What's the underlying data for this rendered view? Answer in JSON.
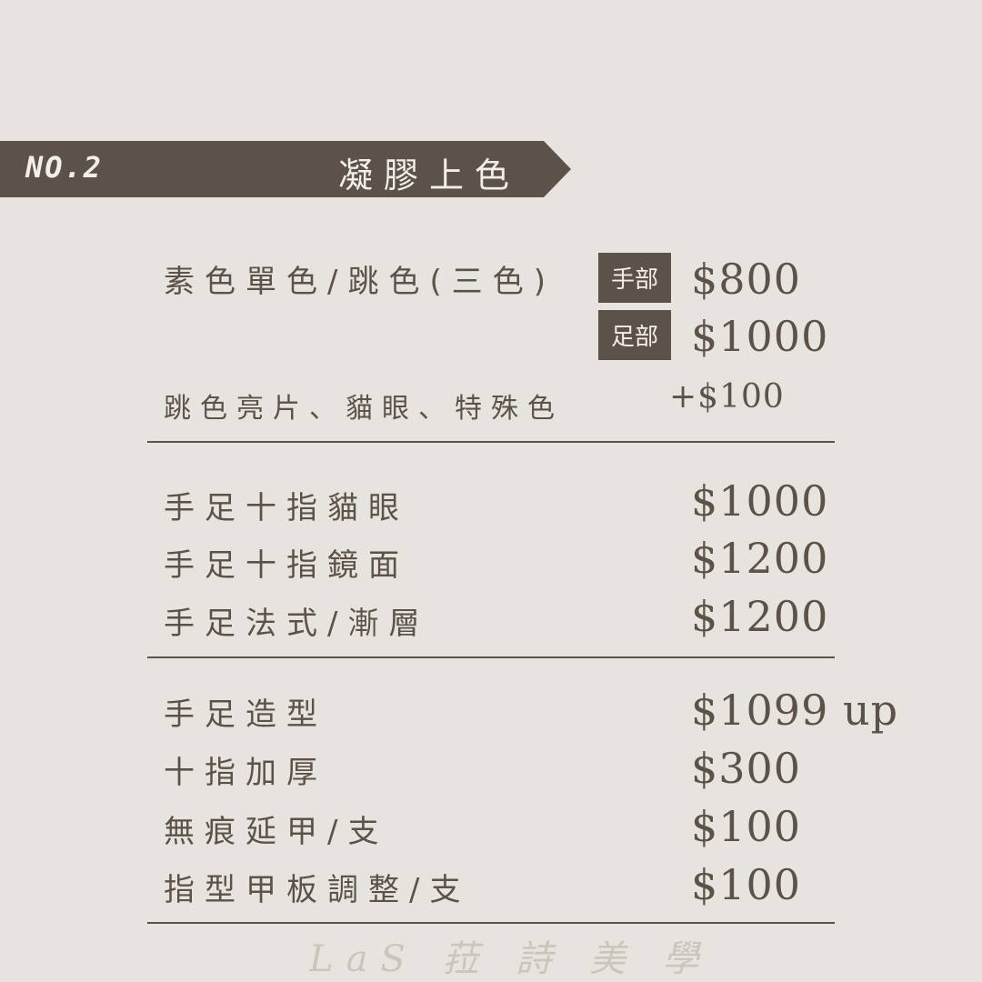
{
  "banner": {
    "number": "NO.2",
    "title": "凝膠上色"
  },
  "section1": {
    "item1": {
      "label": "素色單色/跳色(三色)"
    },
    "tags": [
      {
        "label": "手部",
        "price": "$800"
      },
      {
        "label": "足部",
        "price": "$1000"
      }
    ],
    "item2": {
      "label": "跳色亮片、貓眼、特殊色",
      "price": "+$100"
    }
  },
  "section2": {
    "items": [
      {
        "label": "手足十指貓眼",
        "price": "$1000"
      },
      {
        "label": "手足十指鏡面",
        "price": "$1200"
      },
      {
        "label": "手足法式/漸層",
        "price": "$1200"
      }
    ]
  },
  "section3": {
    "items": [
      {
        "label": "手足造型",
        "price": "$1099 up"
      },
      {
        "label": "十指加厚",
        "price": "$300"
      },
      {
        "label": "無痕延甲/支",
        "price": "$100"
      },
      {
        "label": "指型甲板調整/支",
        "price": "$100"
      }
    ]
  },
  "footer": {
    "brand": "LaS 菈 詩 美 學"
  },
  "colors": {
    "background": "#e7e4df",
    "accent": "#5c5249",
    "footer": "#cbc5bc"
  }
}
